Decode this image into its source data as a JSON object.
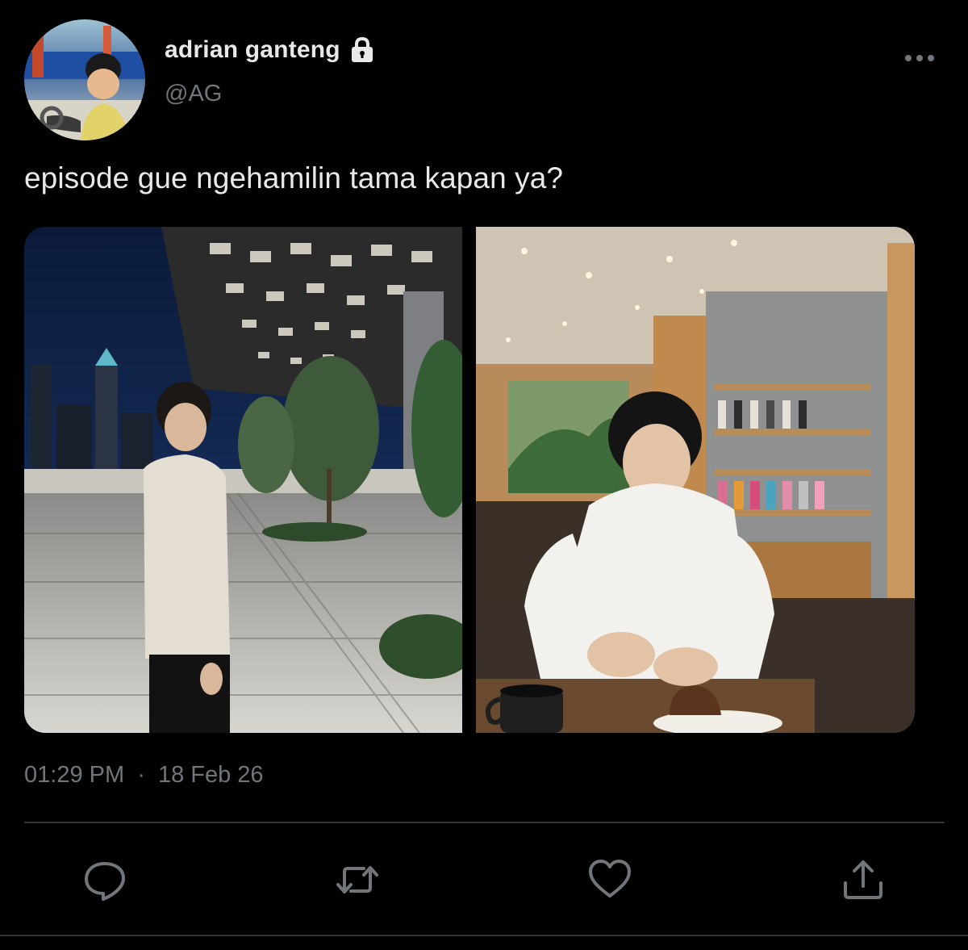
{
  "author": {
    "display_name": "adrian ganteng",
    "handle": "@AG",
    "protected_icon": "lock-icon",
    "avatar": "avatar-photo"
  },
  "tweet": {
    "text": "episode gue ngehamilin tama kapan ya?",
    "time": "01:29 PM",
    "separator": "·",
    "date": "18 Feb 26"
  },
  "media": [
    {
      "type": "photo",
      "description_icon": "photo-night-plaza"
    },
    {
      "type": "photo",
      "description_icon": "photo-cafe"
    }
  ],
  "actions": [
    {
      "name": "reply",
      "icon": "reply-icon"
    },
    {
      "name": "retweet",
      "icon": "retweet-icon"
    },
    {
      "name": "like",
      "icon": "heart-icon"
    },
    {
      "name": "share",
      "icon": "share-icon"
    }
  ],
  "more_icon": "more-icon",
  "colors": {
    "background": "#000000",
    "primary_text": "#e7e9ea",
    "secondary_text": "#71767b",
    "divider": "#2f3336",
    "icon": "#71767b"
  }
}
